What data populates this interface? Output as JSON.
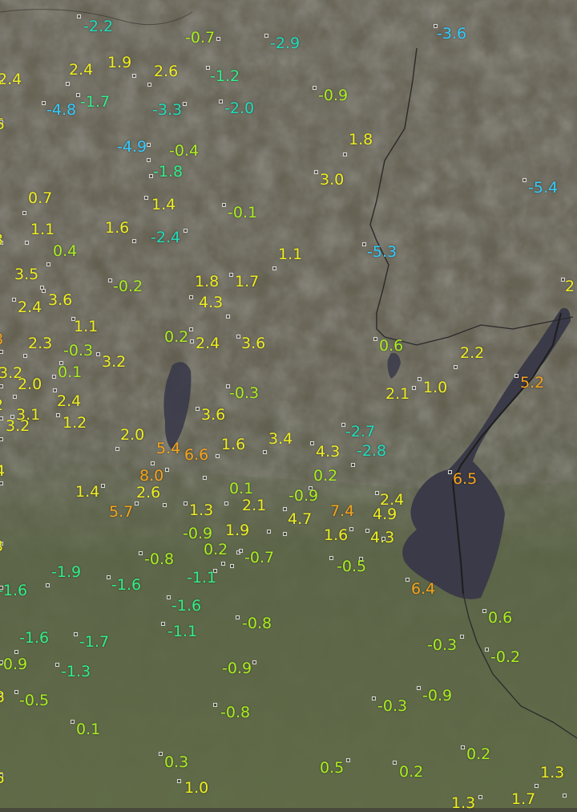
{
  "map": {
    "station_color_scale": {
      "cold_blue": "#33ccff",
      "cool_cyan": "#22ddbb",
      "mild_teal": "#33ee88",
      "lime": "#aaee22",
      "yellow": "#eeee22",
      "orange": "#f7a41c"
    },
    "stations": [
      {
        "v": "-2.2"
      },
      {
        "v": "-0.7"
      },
      {
        "v": "-2.9"
      },
      {
        "v": "-3.6"
      },
      {
        "v": "2.4"
      },
      {
        "v": "1.9"
      },
      {
        "v": "2.6"
      },
      {
        "v": "-1.2"
      },
      {
        "v": "2.4"
      },
      {
        "v": "-0.9"
      },
      {
        "v": "-4.8"
      },
      {
        "v": "-1.7"
      },
      {
        "v": "-3.3"
      },
      {
        "v": "-2.0"
      },
      {
        "v": "5"
      },
      {
        "v": "1.8"
      },
      {
        "v": "-4.9"
      },
      {
        "v": "-0.4"
      },
      {
        "v": "-1.8"
      },
      {
        "v": "3.0"
      },
      {
        "v": "-5.4"
      },
      {
        "v": "0.7"
      },
      {
        "v": "1.4"
      },
      {
        "v": "-0.1"
      },
      {
        "v": "1.1"
      },
      {
        "v": "1.6"
      },
      {
        "v": "-2.4"
      },
      {
        "v": "3"
      },
      {
        "v": "0.4"
      },
      {
        "v": "-5.3"
      },
      {
        "v": "1.1"
      },
      {
        "v": "3.5"
      },
      {
        "v": "1.8"
      },
      {
        "v": "1.7"
      },
      {
        "v": "-0.2"
      },
      {
        "v": "2"
      },
      {
        "v": "2.4"
      },
      {
        "v": "3.6"
      },
      {
        "v": "4.3"
      },
      {
        "v": "1.1"
      },
      {
        "v": "0.2"
      },
      {
        "v": "8"
      },
      {
        "v": "2.3"
      },
      {
        "v": "-0.3"
      },
      {
        "v": "2.4"
      },
      {
        "v": "3.6"
      },
      {
        "v": "0.6"
      },
      {
        "v": "2.2"
      },
      {
        "v": "3.2"
      },
      {
        "v": "3.2"
      },
      {
        "v": "0.1"
      },
      {
        "v": "5.2"
      },
      {
        "v": "2.0"
      },
      {
        "v": "-0.3"
      },
      {
        "v": "2.1"
      },
      {
        "v": "1.0"
      },
      {
        "v": "2"
      },
      {
        "v": "2.4"
      },
      {
        "v": "3.1"
      },
      {
        "v": "3.6"
      },
      {
        "v": "1.2"
      },
      {
        "v": "3.2"
      },
      {
        "v": "2.0"
      },
      {
        "v": "-2.7"
      },
      {
        "v": "5.4"
      },
      {
        "v": "6.6"
      },
      {
        "v": "1.6"
      },
      {
        "v": "3.4"
      },
      {
        "v": "4.3"
      },
      {
        "v": "-2.8"
      },
      {
        "v": "4"
      },
      {
        "v": "8.0"
      },
      {
        "v": "0.2"
      },
      {
        "v": "6.5"
      },
      {
        "v": "1.4"
      },
      {
        "v": "2.6"
      },
      {
        "v": "0.1"
      },
      {
        "v": "-0.9"
      },
      {
        "v": "2.4"
      },
      {
        "v": "5.7"
      },
      {
        "v": "1.3"
      },
      {
        "v": "2.1"
      },
      {
        "v": "7.4"
      },
      {
        "v": "4.7"
      },
      {
        "v": "4.9"
      },
      {
        "v": "3"
      },
      {
        "v": "-0.9"
      },
      {
        "v": "1.9"
      },
      {
        "v": "1.6"
      },
      {
        "v": "4.3"
      },
      {
        "v": "0.2"
      },
      {
        "v": "-0.7"
      },
      {
        "v": "-0.8"
      },
      {
        "v": "-0.5"
      },
      {
        "v": "-1.9"
      },
      {
        "v": "-1.1"
      },
      {
        "v": "-1.6"
      },
      {
        "v": "-1.6"
      },
      {
        "v": "6.4"
      },
      {
        "v": "-1.6"
      },
      {
        "v": "0.6"
      },
      {
        "v": "-1.1"
      },
      {
        "v": "-0.8"
      },
      {
        "v": "-1.6"
      },
      {
        "v": "-1.7"
      },
      {
        "v": "-0.3"
      },
      {
        "v": "-0.9"
      },
      {
        "v": "-0.2"
      },
      {
        "v": "-1.3"
      },
      {
        "v": "-0.9"
      },
      {
        "v": "3"
      },
      {
        "v": "-0.5"
      },
      {
        "v": "-0.9"
      },
      {
        "v": "-0.3"
      },
      {
        "v": "-0.8"
      },
      {
        "v": "0.1"
      },
      {
        "v": "0.3"
      },
      {
        "v": "0.2"
      },
      {
        "v": "0.5"
      },
      {
        "v": "0.2"
      },
      {
        "v": "1.3"
      },
      {
        "v": "5"
      },
      {
        "v": "1.0"
      },
      {
        "v": "1.3"
      },
      {
        "v": "1.7"
      }
    ]
  }
}
